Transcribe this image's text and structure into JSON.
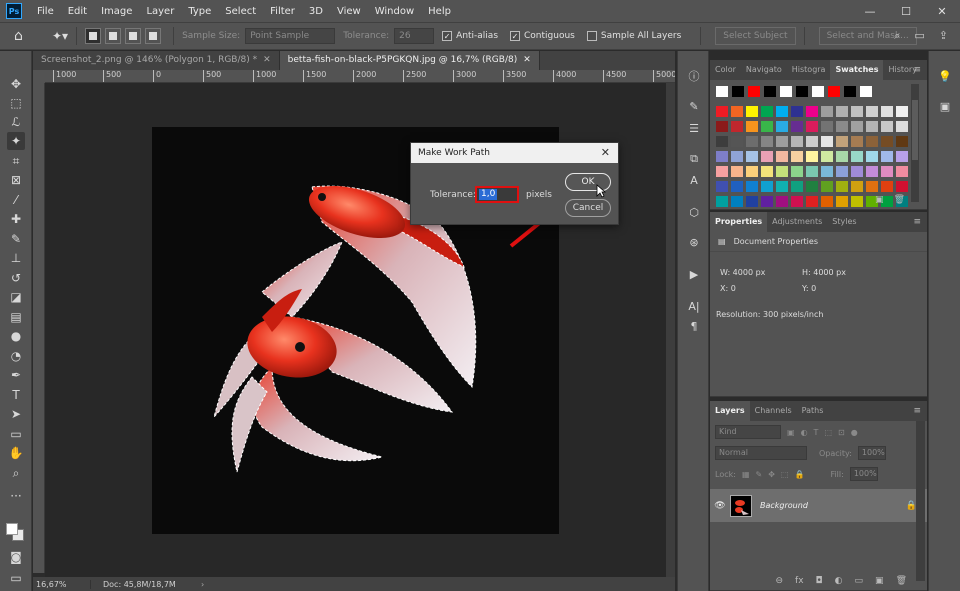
{
  "menubar": {
    "logo": "Ps",
    "items": [
      "File",
      "Edit",
      "Image",
      "Layer",
      "Type",
      "Select",
      "Filter",
      "3D",
      "View",
      "Window",
      "Help"
    ],
    "win_min": "—",
    "win_max": "☐",
    "win_close": "✕"
  },
  "options": {
    "sample_size_label": "Sample Size:",
    "sample_size_value": "Point Sample",
    "tolerance_label": "Tolerance:",
    "tolerance_value": "26",
    "anti_alias": "Anti-alias",
    "contiguous": "Contiguous",
    "sample_all": "Sample All Layers",
    "select_subject": "Select Subject",
    "select_mask": "Select and Mask..."
  },
  "tabs": [
    {
      "label": "Screenshot_2.png @ 146% (Polygon 1, RGB/8) *",
      "close": "✕"
    },
    {
      "label": "betta-fish-on-black-P5PGKQN.jpg @ 16,7% (RGB/8)",
      "close": "✕"
    }
  ],
  "ruler": {
    "ticks": [
      "1000",
      "500",
      "0",
      "500",
      "1000",
      "1500",
      "2000",
      "2500",
      "3000",
      "3500",
      "4000",
      "4500",
      "5000"
    ]
  },
  "status": {
    "zoom": "16,67%",
    "doc": "Doc: 45,8M/18,7M",
    "arrow": "›"
  },
  "dialog": {
    "title": "Make Work Path",
    "close": "✕",
    "tolerance_label": "Tolerance:",
    "tolerance_value": "1,0",
    "unit": "pixels",
    "ok": "OK",
    "cancel": "Cancel"
  },
  "swatches_panel": {
    "tabs": [
      "Color",
      "Navigato",
      "Histogra",
      "Swatches",
      "History"
    ],
    "active_tab": "Swatches",
    "menu": "≡",
    "footer_new": "▣",
    "footer_delete": "🗑"
  },
  "properties_panel": {
    "tabs": [
      "Properties",
      "Adjustments",
      "Styles"
    ],
    "menu": "≡",
    "doc_title": "Document Properties",
    "w": "W:  4000 px",
    "h": "H:  4000 px",
    "x": "X:  0",
    "y": "Y:  0",
    "resolution": "Resolution: 300 pixels/inch"
  },
  "layers_panel": {
    "tabs": [
      "Layers",
      "Channels",
      "Paths"
    ],
    "menu": "≡",
    "kind": "Kind",
    "blend": "Normal",
    "opacity_label": "Opacity:",
    "opacity": "100%",
    "lock_label": "Lock:",
    "fill_label": "Fill:",
    "fill": "100%",
    "layer_name": "Background",
    "footer": [
      "⊖",
      "fx",
      "◘",
      "◐",
      "▭",
      "▣",
      "🗑"
    ]
  },
  "colors": {
    "accent_red": "#e01010",
    "selection_blue": "#2a6bd5"
  }
}
